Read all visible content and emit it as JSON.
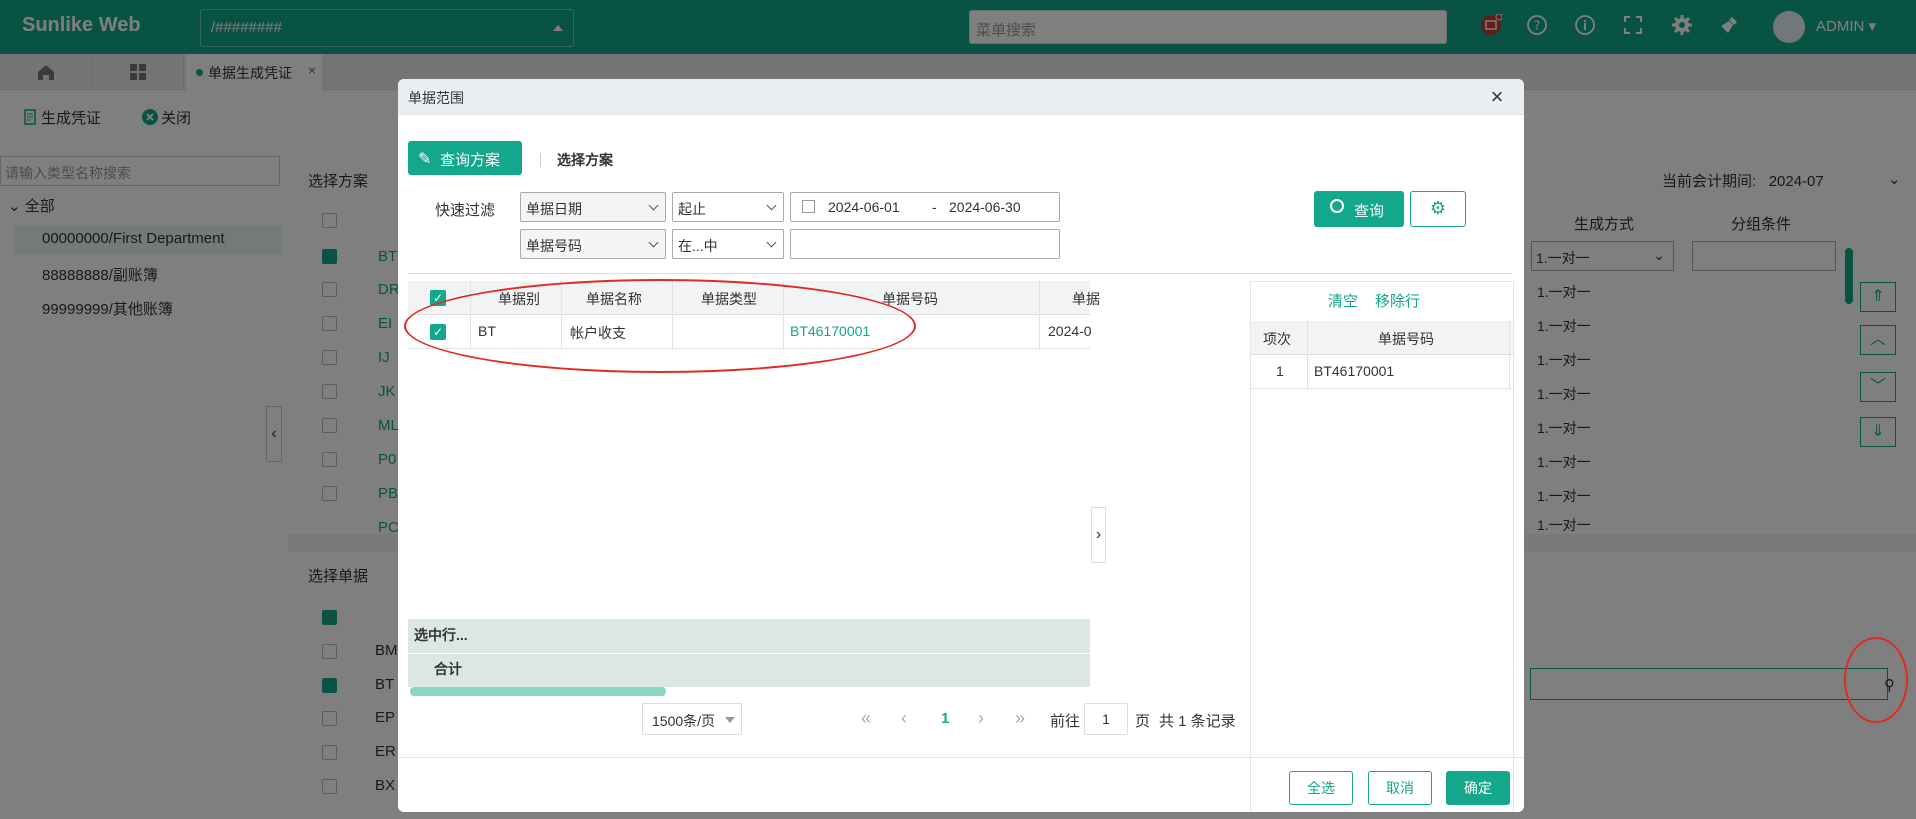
{
  "header": {
    "brand": "Sunlike Web",
    "account_select": "/########",
    "search_placeholder": "菜单搜索",
    "user": "ADMIN",
    "colors": {
      "primary": "#13a78b",
      "alert": "#e02a24"
    }
  },
  "tabs": {
    "active": "单据生成凭证"
  },
  "toolbar": {
    "generate": "生成凭证",
    "close": "关闭"
  },
  "tree": {
    "search_placeholder": "请输入类型名称搜索",
    "root": "全部",
    "items": [
      "00000000/First Department",
      "88888888/副账簿",
      "99999999/其他账簿"
    ]
  },
  "scheme_panel": {
    "title": "选择方案",
    "period_label": "当前会计期间:",
    "period_value": "2024-07",
    "col_generate": "生成方式",
    "col_group": "分组条件",
    "codes": [
      "BT",
      "DR",
      "EI",
      "IJ",
      "JK",
      "ML",
      "P0",
      "PB",
      "PC"
    ],
    "modes": [
      "1.一对一",
      "1.一对一",
      "1.一对一",
      "1.一对一",
      "1.一对一",
      "1.一对一",
      "1.一对一",
      "1.一对一"
    ],
    "selected_mode": "1.一对一"
  },
  "doc_panel": {
    "title": "选择单据",
    "codes": [
      "BM",
      "BT",
      "EP",
      "ER",
      "BX"
    ]
  },
  "dialog": {
    "title": "单据范围",
    "query_scheme": "查询方案",
    "select_scheme": "选择方案",
    "quick_filter": "快速过滤",
    "field1": "单据日期",
    "op1": "起止",
    "date_start": "2024-06-01",
    "date_sep": "-",
    "date_end": "2024-06-30",
    "field2": "单据号码",
    "op2": "在...中",
    "query": "查询",
    "columns": [
      "单据别",
      "单据名称",
      "单据类型",
      "单据号码",
      "单据"
    ],
    "row": {
      "code": "BT",
      "name": "帐户收支",
      "type": "",
      "number": "BT46170001",
      "date": "2024-0"
    },
    "selected_rows": "选中行...",
    "total": "合计",
    "pager": {
      "page_size": "1500条/页",
      "current": "1",
      "goto_label": "前往",
      "goto_value": "1",
      "page_unit": "页",
      "total_records": "共 1 条记录"
    },
    "side": {
      "clear": "清空",
      "remove": "移除行",
      "col_seq": "项次",
      "col_number": "单据号码",
      "row_seq": "1",
      "row_number": "BT46170001"
    },
    "buttons": {
      "select_all": "全选",
      "cancel": "取消",
      "confirm": "确定"
    }
  }
}
